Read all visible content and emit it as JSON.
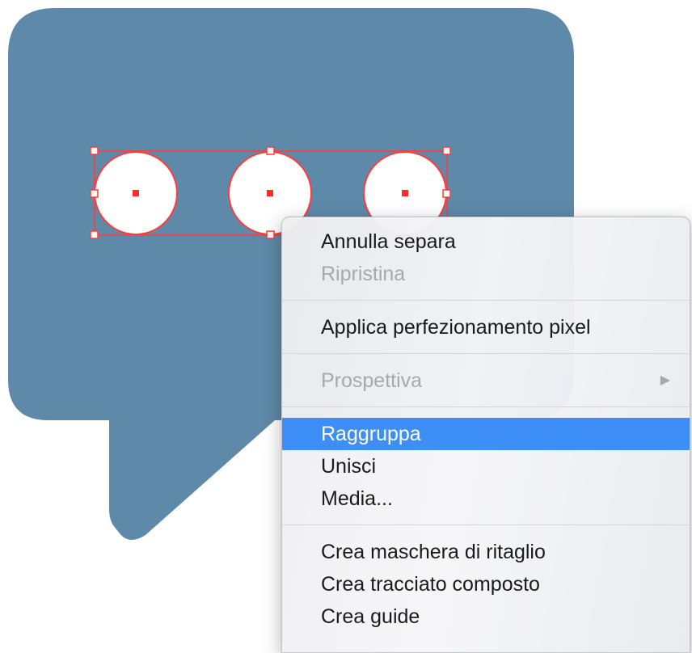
{
  "colors": {
    "bubble": "#5f89a8",
    "selection": "#ff3b3b",
    "menu_highlight": "#3e8ef7"
  },
  "canvas": {
    "objects": [
      {
        "name": "speech-bubble-shape"
      },
      {
        "name": "circle-1"
      },
      {
        "name": "circle-2"
      },
      {
        "name": "circle-3"
      }
    ]
  },
  "context_menu": {
    "groups": [
      [
        {
          "label": "Annulla separa",
          "enabled": true
        },
        {
          "label": "Ripristina",
          "enabled": false
        }
      ],
      [
        {
          "label": "Applica perfezionamento pixel",
          "enabled": true
        }
      ],
      [
        {
          "label": "Prospettiva",
          "enabled": false,
          "submenu": true,
          "submenu_icon": "chevron-right-icon"
        }
      ],
      [
        {
          "label": "Raggruppa",
          "enabled": true,
          "highlighted": true
        },
        {
          "label": "Unisci",
          "enabled": true
        },
        {
          "label": "Media...",
          "enabled": true
        }
      ],
      [
        {
          "label": "Crea maschera di ritaglio",
          "enabled": true
        },
        {
          "label": "Crea tracciato composto",
          "enabled": true
        },
        {
          "label": "Crea guide",
          "enabled": true
        }
      ]
    ]
  }
}
